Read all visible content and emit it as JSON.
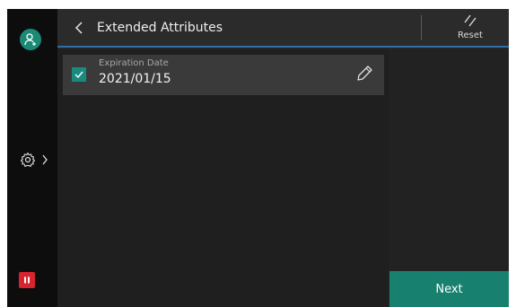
{
  "header": {
    "title": "Extended Attributes",
    "reset_label": "Reset"
  },
  "attributes": [
    {
      "label": "Expiration Date",
      "value": "2021/01/15",
      "checked": true
    }
  ],
  "footer": {
    "next_label": "Next"
  },
  "colors": {
    "accent_teal": "#1a8a76",
    "pause_red": "#d8242f",
    "header_underline": "#2f6fa6"
  },
  "icons": [
    "user-icon",
    "settings-icon",
    "chevron-right-icon",
    "pause-icon",
    "back-icon",
    "reset-icon",
    "checkmark-icon",
    "pencil-icon"
  ]
}
